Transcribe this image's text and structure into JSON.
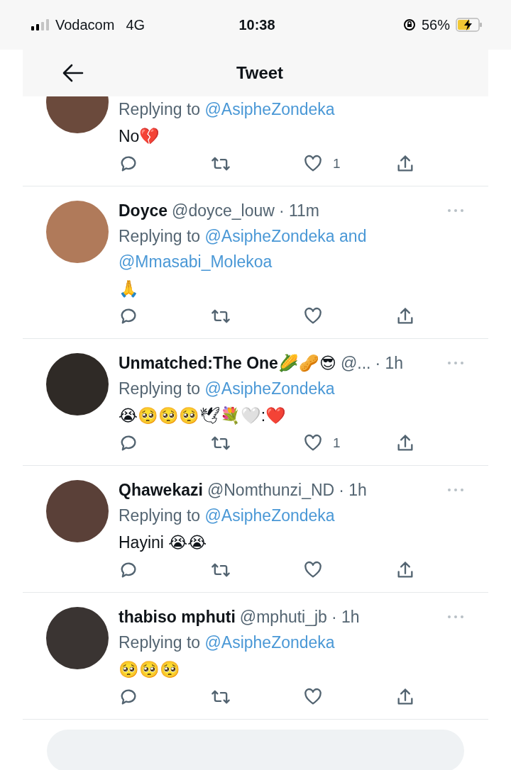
{
  "status_bar": {
    "carrier": "Vodacom",
    "network": "4G",
    "time": "10:38",
    "battery": "56%"
  },
  "header": {
    "title": "Tweet"
  },
  "tweets": [
    {
      "replying": {
        "prefix": "Replying to",
        "mentions": [
          "@AsipheZondeka"
        ]
      },
      "body": "No💔",
      "likes": "1"
    },
    {
      "name": "Doyce",
      "handle": "@doyce_louw",
      "time": "· 11m",
      "replying": {
        "prefix": "Replying to",
        "mentions": [
          "@AsipheZondeka",
          "@Mmasabi_Molekoa"
        ],
        "joiner": "and"
      },
      "body": "🙏"
    },
    {
      "name": "Unmatched:The One🌽🥜😎",
      "handle": "@...",
      "time": "· 1h",
      "replying": {
        "prefix": "Replying to",
        "mentions": [
          "@AsipheZondeka"
        ]
      },
      "body": "😭🥺🥺🥺🕊💐🤍:❤️",
      "likes": "1"
    },
    {
      "name": "Qhawekazi",
      "handle": "@Nomthunzi_ND",
      "time": "· 1h",
      "replying": {
        "prefix": "Replying to",
        "mentions": [
          "@AsipheZondeka"
        ]
      },
      "body": "Hayini 😭😭"
    },
    {
      "name": "thabiso mphuti",
      "handle": "@mphuti_jb",
      "time": "· 1h",
      "replying": {
        "prefix": "Replying to",
        "mentions": [
          "@AsipheZondeka"
        ]
      },
      "body": "🥺🥺🥺"
    }
  ]
}
